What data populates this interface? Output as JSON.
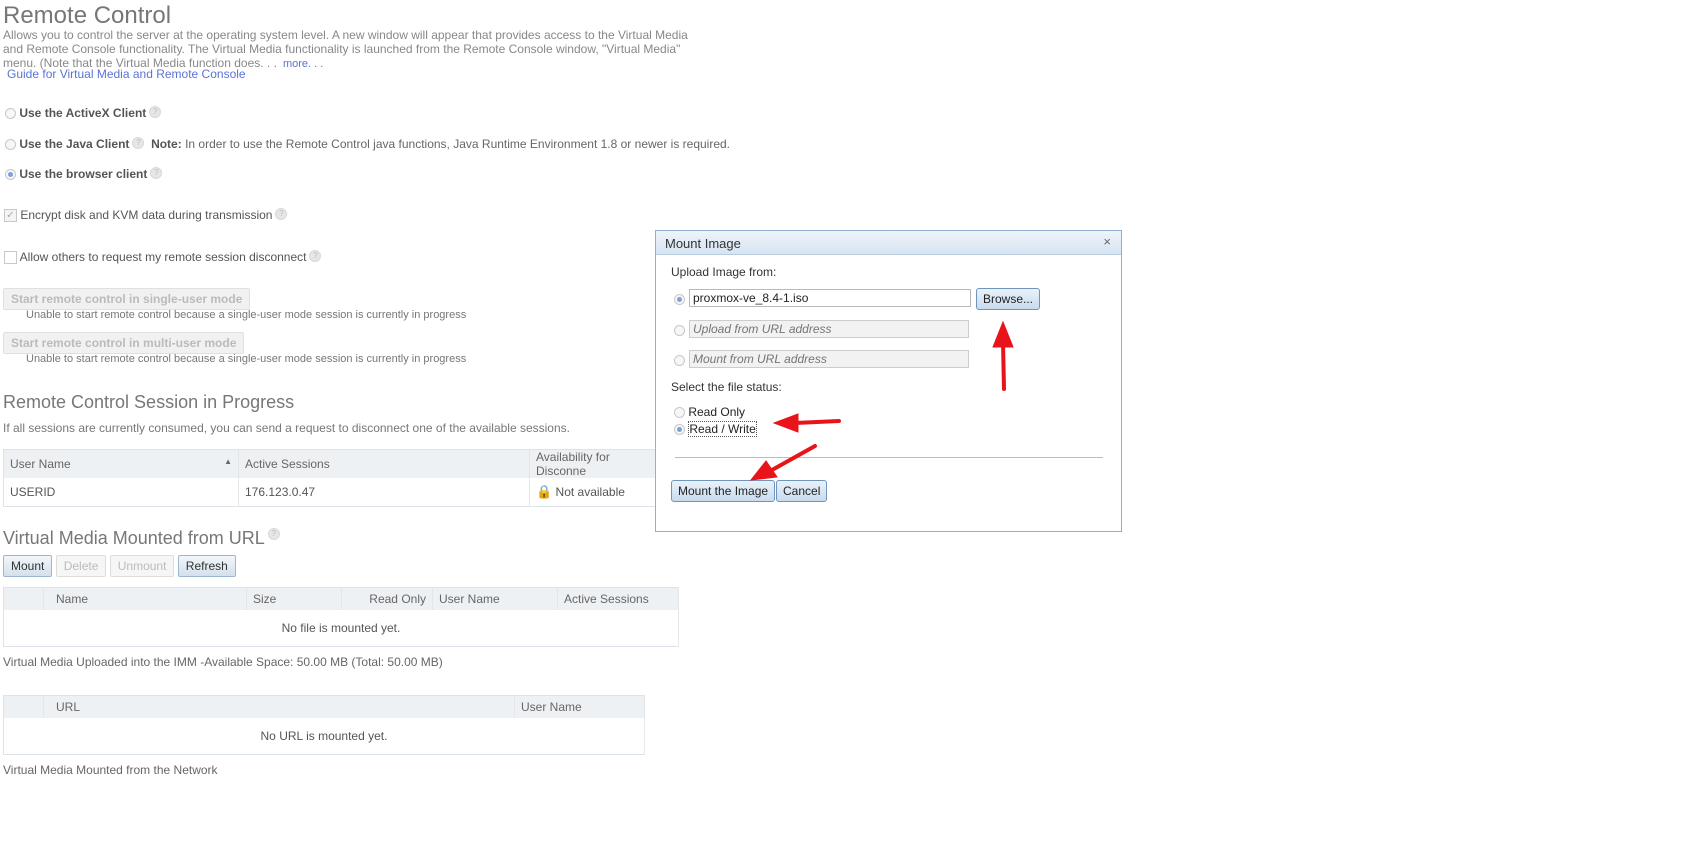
{
  "page": {
    "title": "Remote Control",
    "description_lines": [
      "Allows you to control the server at the operating system level. A new window will appear that provides access to the Virtual Media",
      "and Remote Console functionality. The Virtual Media functionality is launched from the Remote Console window, \"Virtual Media\"",
      "menu. (Note that the Virtual Media function does. . ."
    ],
    "more_link": "more. . .",
    "guide_link": "Guide for Virtual Media and Remote Console"
  },
  "client_options": [
    {
      "label": "Use the ActiveX Client",
      "selected": false
    },
    {
      "label": "Use the Java Client",
      "selected": false,
      "note_label": "Note:",
      "note_text": "In order to use the Remote Control java functions, Java Runtime Environment 1.8 or newer is required."
    },
    {
      "label": "Use the browser client",
      "selected": true
    }
  ],
  "checkboxes": {
    "encrypt": {
      "label": "Encrypt disk and KVM data during transmission",
      "checked": true
    },
    "allow_disconnect": {
      "label": "Allow others to request my remote session disconnect",
      "checked": false
    }
  },
  "start_buttons": [
    {
      "label": "Start remote control in single-user mode",
      "note": "Unable to start remote control because a single-user mode session is currently in progress"
    },
    {
      "label": "Start remote control in multi-user mode",
      "note": "Unable to start remote control because a single-user mode session is currently in progress"
    }
  ],
  "sessions": {
    "title": "Remote Control Session in Progress",
    "subtitle": "If all sessions are currently consumed, you can send a request to disconnect one of the available sessions.",
    "columns": [
      "User Name",
      "Active Sessions",
      "Availability for Disconne"
    ],
    "rows": [
      {
        "user": "USERID",
        "sessions": "176.123.0.47",
        "availability": "Not available"
      }
    ]
  },
  "vm_url": {
    "title": "Virtual Media Mounted from URL",
    "buttons": {
      "mount": "Mount",
      "delete": "Delete",
      "unmount": "Unmount",
      "refresh": "Refresh"
    },
    "columns": [
      "Name",
      "Size",
      "Read Only",
      "User Name",
      "Active Sessions"
    ],
    "empty": "No file is mounted yet.",
    "footer": "Virtual Media Uploaded into the IMM -Available Space: 50.00 MB (Total: 50.00 MB)"
  },
  "vm_network": {
    "columns": [
      "URL",
      "User Name"
    ],
    "empty": "No URL is mounted yet.",
    "footer": "Virtual Media Mounted from the Network"
  },
  "dialog": {
    "title": "Mount Image",
    "close": "×",
    "upload_label": "Upload Image from:",
    "file_value": "proxmox-ve_8.4-1.iso",
    "browse": "Browse...",
    "upload_url_placeholder": "Upload from URL address",
    "mount_url_placeholder": "Mount from URL address",
    "status_label": "Select the file status:",
    "status_options": [
      {
        "label": "Read Only",
        "selected": false
      },
      {
        "label": "Read / Write",
        "selected": true
      }
    ],
    "mount_button": "Mount the Image",
    "cancel_button": "Cancel"
  },
  "colors": {
    "annotation_arrow": "#e8141a",
    "link": "#5a73d6",
    "dialog_border": "#8fb0d0"
  }
}
